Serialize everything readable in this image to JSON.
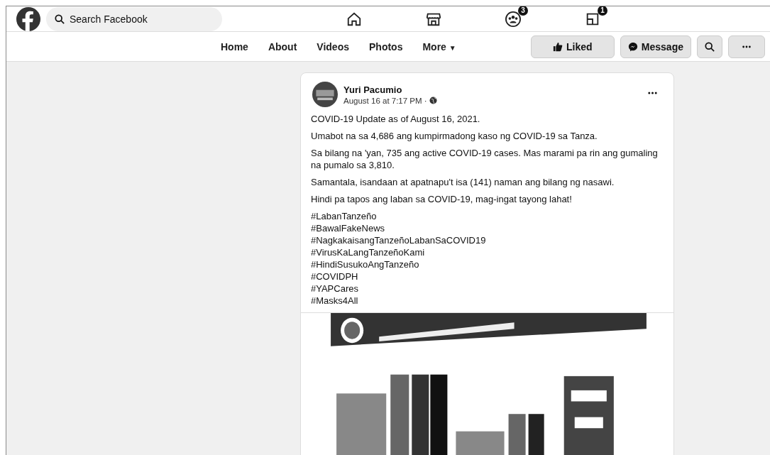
{
  "top_bar": {
    "search": {
      "placeholder": "Search Facebook"
    },
    "nav_icons": [
      {
        "kind": "home"
      },
      {
        "kind": "store"
      },
      {
        "kind": "groups",
        "badge": "3"
      },
      {
        "kind": "pages",
        "badge": "1"
      }
    ]
  },
  "page_nav": {
    "tabs": [
      "Home",
      "About",
      "Videos",
      "Photos"
    ],
    "more": {
      "label": "More",
      "caret": "▼"
    },
    "actions": [
      {
        "kind": "liked",
        "label": "Liked"
      },
      {
        "kind": "message",
        "label": "Message"
      },
      {
        "kind": "search"
      },
      {
        "kind": "more"
      }
    ]
  },
  "post": {
    "author": "Yuri Pacumio",
    "time": "August 16 at 7:17 PM ·",
    "paragraphs": [
      "COVID-19 Update as of August 16, 2021.",
      "Umabot na sa 4,686 ang kumpirmadong kaso ng COVID-19 sa Tanza.",
      "Sa bilang na 'yan, 735 ang active COVID-19 cases. Mas marami pa rin ang gumaling na pumalo sa 3,810.",
      "Samantala, isandaan at apatnapu't isa (141) naman ang bilang ng nasawi.",
      "Hindi pa tapos ang laban sa COVID-19, mag-ingat tayong lahat!"
    ],
    "hashtags": [
      "#LabanTanzeño",
      "#BawalFakeNews",
      "#NagkakaisangTanzeñoLabanSaCOVID19",
      "#VirusKaLangTanzeñoKami",
      "#HindiSusukoAngTanzeño",
      "#COVIDPH",
      "#YAPCares",
      "#Masks4All"
    ]
  }
}
